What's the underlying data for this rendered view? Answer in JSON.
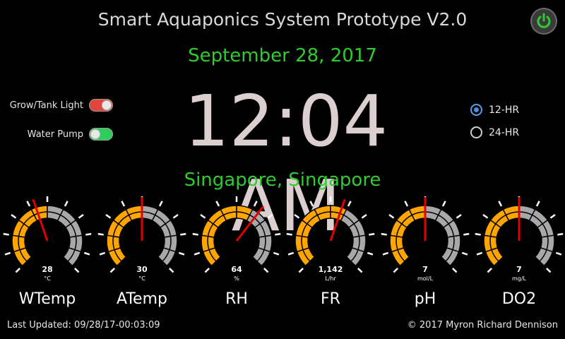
{
  "header": {
    "title": "Smart Aquaponics System Prototype V2.0",
    "date": "September 28, 2017",
    "power_icon": "power-icon",
    "power_color": "#2ecc2e"
  },
  "toggles": [
    {
      "label": "Grow/Tank Light",
      "on": false,
      "color": "#e0443a"
    },
    {
      "label": "Water Pump",
      "on": true,
      "color": "#2ecc5a"
    }
  ],
  "clock": {
    "time": "12:04 AM"
  },
  "time_format": {
    "options": [
      "12-HR",
      "24-HR"
    ],
    "selected": "12-HR"
  },
  "location": "Singapore, Singapore",
  "gauges": [
    {
      "name": "WTemp",
      "value": "28",
      "unit": "°C",
      "fraction": 0.45,
      "needle": 0.43
    },
    {
      "name": "ATemp",
      "value": "30",
      "unit": "°C",
      "fraction": 0.5,
      "needle": 0.5
    },
    {
      "name": "RH",
      "value": "64",
      "unit": "%",
      "fraction": 0.64,
      "needle": 0.64
    },
    {
      "name": "FR",
      "value": "1,142",
      "unit": "L/hr",
      "fraction": 0.55,
      "needle": 0.57
    },
    {
      "name": "pH",
      "value": "7",
      "unit": "mol/L",
      "fraction": 0.5,
      "needle": 0.5
    },
    {
      "name": "DO2",
      "value": "7",
      "unit": "mg/L",
      "fraction": 0.5,
      "needle": 0.5
    }
  ],
  "colors": {
    "gauge_fill": "#ffa500",
    "gauge_empty": "#a8a8a8",
    "needle": "#e00000",
    "accent_green": "#2ecc2e"
  },
  "footer": {
    "last_updated": "Last Updated: 09/28/17-00:03:09",
    "copyright": "© 2017 Myron Richard Dennison"
  }
}
